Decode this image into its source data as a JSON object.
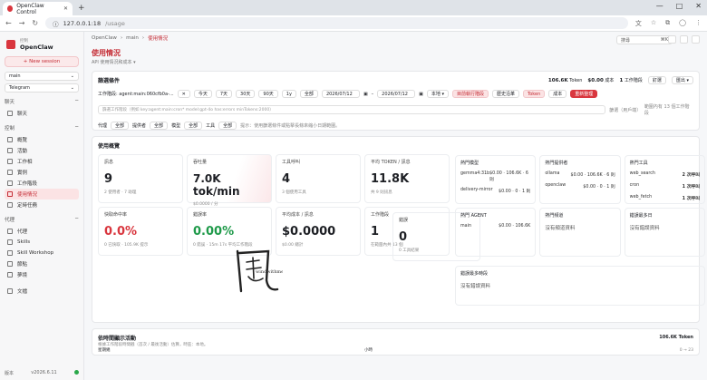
{
  "browser": {
    "tab_title": "OpenClaw Control",
    "url_host": "127.0.0.1:18",
    "url_path": "/usage",
    "new_tab": "+",
    "controls": [
      "—",
      "□",
      "✕"
    ]
  },
  "sidebar": {
    "brand_small": "控制",
    "brand_name": "OpenClaw",
    "new_session": "+ New session",
    "select_agent": "main",
    "select_channel": "Telegram",
    "sections": [
      {
        "title": "聊天",
        "items": [
          {
            "label": "聊天"
          }
        ]
      },
      {
        "title": "控制",
        "items": [
          {
            "label": "概覽"
          },
          {
            "label": "活動"
          },
          {
            "label": "工作相"
          },
          {
            "label": "實例"
          },
          {
            "label": "工作階段"
          },
          {
            "label": "使用情況",
            "active": true
          },
          {
            "label": "定時任務"
          }
        ]
      },
      {
        "title": "代理",
        "items": [
          {
            "label": "代理"
          },
          {
            "label": "Skills"
          },
          {
            "label": "Skill Workshop"
          },
          {
            "label": "節點"
          },
          {
            "label": "夢境"
          }
        ]
      },
      {
        "title": "",
        "items": [
          {
            "label": "文檔"
          }
        ]
      }
    ],
    "version_label": "版本",
    "version": "v2026.6.11"
  },
  "topbar": {
    "crumbs": [
      "OpenClaw",
      "main",
      "使用情況"
    ],
    "search_placeholder": "搜尋",
    "search_shortcut": "⌘K"
  },
  "page": {
    "title": "使用情況",
    "subtitle": "API 使用情況和成本 ▾"
  },
  "filters": {
    "title": "篩選條件",
    "summary": {
      "tokens": "106.6K",
      "tokens_label": "Token",
      "cost": "$0.00",
      "cost_label": "成本",
      "sessions": "1",
      "sessions_label": "工作階段",
      "pin": "釘選",
      "export": "匯出 ▾"
    },
    "session_label": "工作階段: agent:main:060cfb0a-...",
    "ranges": [
      "今天",
      "7天",
      "30天",
      "90天",
      "1y",
      "全部"
    ],
    "date_from": "2026/07/12",
    "date_to": "2026/07/12",
    "tz": "本地 ▾",
    "mode_a": "目前執行階段",
    "mode_b": "歷史沿革",
    "metric_a": "Token",
    "metric_b": "成本",
    "refresh": "重新整理",
    "query_placeholder": "篩選工作階段（例如 key:agent:main:cron* model:gpt-4o has:errors minTokens:2000）",
    "query_right": "篩選（用戶端）",
    "query_match": "範圍內有 13 個工作階段",
    "facets": [
      {
        "label": "代理",
        "value": "全部"
      },
      {
        "label": "提供者",
        "value": "全部"
      },
      {
        "label": "模型",
        "value": "全部"
      },
      {
        "label": "工具",
        "value": "全部"
      }
    ],
    "hint": "提示：使用篩選條件或點擊長條來縮小日期範圍。"
  },
  "overview": {
    "title": "使用概覽",
    "stats": [
      {
        "label": "訊息",
        "value": "9",
        "note": "2 使用者 · 7 助理",
        "style": ""
      },
      {
        "label": "吞吐量",
        "value": "7.0K tok/min",
        "note": "$0.0000 / 分",
        "style": "glow"
      },
      {
        "label": "工具呼叫",
        "value": "4",
        "note": "3 個使用工具",
        "style": ""
      },
      {
        "label": "平均 TOKEN / 訊息",
        "value": "11.8K",
        "note": "共 9 則訊息",
        "style": ""
      },
      {
        "label": "快取命中率",
        "value": "0.0%",
        "note": "0 已快取 · 105.9K 提示",
        "style": "red"
      },
      {
        "label": "錯誤率",
        "value": "0.00%",
        "note": "0 錯誤 · 15m 17s 平均工作階段",
        "style": "green"
      },
      {
        "label": "平均成本 / 訊息",
        "value": "$0.0000",
        "note": "$0.00 總計",
        "style": ""
      },
      {
        "label": "工作階段",
        "value": "1",
        "note": "在範圍內共 13 個",
        "style": ""
      },
      {
        "label": "錯誤",
        "value": "0",
        "note": "0 工具結果",
        "style": ""
      }
    ],
    "panels": [
      {
        "title": "熱門模型",
        "rows": [
          {
            "k": "gemma4:31b",
            "v": "$0.00 · 106.6K · 6 則"
          },
          {
            "k": "delivery-mirror",
            "v": "$0.00 · 0 · 1 則"
          }
        ]
      },
      {
        "title": "熱門提供者",
        "rows": [
          {
            "k": "ollama",
            "v": "$0.00 · 106.6K · 6 則"
          },
          {
            "k": "openclaw",
            "v": "$0.00 · 0 · 1 則"
          }
        ]
      },
      {
        "title": "熱門工具",
        "rows": [
          {
            "k": "web_search",
            "v": "2 次呼叫"
          },
          {
            "k": "cron",
            "v": "1 次呼叫"
          },
          {
            "k": "web_fetch",
            "v": "1 次呼叫"
          }
        ]
      },
      {
        "title": "熱門 AGENT",
        "rows": [
          {
            "k": "main",
            "v": "$0.00 · 106.6K"
          }
        ]
      },
      {
        "title": "熱門頻道",
        "empty": "沒有頻道資料"
      },
      {
        "title": "錯誤最多日",
        "empty": "沒有錯誤資料"
      }
    ],
    "timeline_title": "錯誤最多時段",
    "timeline_empty": "沒有錯誤資料",
    "calligraphy": "風",
    "calligraphy_signature": "windwithme"
  },
  "activity": {
    "title": "依時間顯示活動",
    "subtitle": "根據工作階段時間戳（首次 / 最後活動）估算，時區：本地。",
    "total": "106.6K Token",
    "weekday_label": "星期幾",
    "hour_label": "小時",
    "range": "0 → 23"
  }
}
